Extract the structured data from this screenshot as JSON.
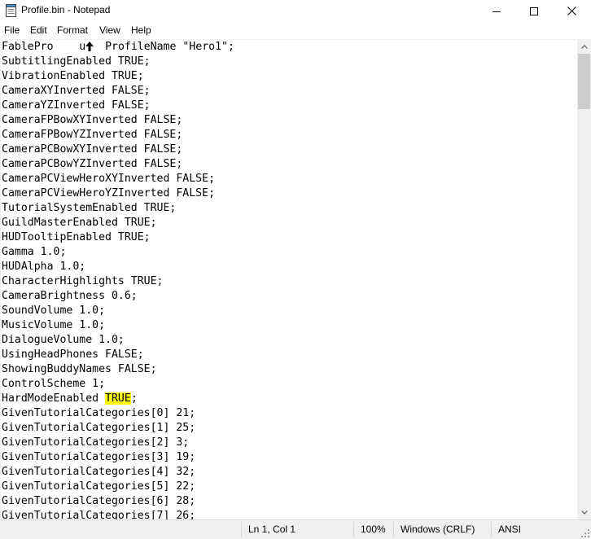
{
  "window": {
    "title": "Profile.bin - Notepad",
    "icon": "notepad-icon"
  },
  "menu": [
    "File",
    "Edit",
    "Format",
    "View",
    "Help"
  ],
  "editor": {
    "line1": {
      "prefix": "FablePro    u",
      "cursor_icon": "mouse-pointer-icon",
      "suffix": "  ProfileName \"Hero1\";"
    },
    "lines": [
      "SubtitlingEnabled TRUE;",
      "VibrationEnabled TRUE;",
      "CameraXYInverted FALSE;",
      "CameraYZInverted FALSE;",
      "CameraFPBowXYInverted FALSE;",
      "CameraFPBowYZInverted FALSE;",
      "CameraPCBowXYInverted FALSE;",
      "CameraPCBowYZInverted FALSE;",
      "CameraPCViewHeroXYInverted FALSE;",
      "CameraPCViewHeroYZInverted FALSE;",
      "TutorialSystemEnabled TRUE;",
      "GuildMasterEnabled TRUE;",
      "HUDTooltipEnabled TRUE;",
      "Gamma 1.0;",
      "HUDAlpha 1.0;",
      "CharacterHighlights TRUE;",
      "CameraBrightness 0.6;",
      "SoundVolume 1.0;",
      "MusicVolume 1.0;",
      "DialogueVolume 1.0;",
      "UsingHeadPhones FALSE;",
      "ShowingBuddyNames FALSE;",
      "ControlScheme 1;"
    ],
    "highlighted_line": {
      "prefix": "HardModeEnabled ",
      "highlight": "TRUE",
      "suffix": ";"
    },
    "lines_after": [
      "GivenTutorialCategories[0] 21;",
      "GivenTutorialCategories[1] 25;",
      "GivenTutorialCategories[2] 3;",
      "GivenTutorialCategories[3] 19;",
      "GivenTutorialCategories[4] 32;",
      "GivenTutorialCategories[5] 22;",
      "GivenTutorialCategories[6] 28;",
      "GivenTutorialCategories[7] 26;"
    ],
    "highlight_color": "#ffff00"
  },
  "status": {
    "position": "Ln 1, Col 1",
    "zoom": "100%",
    "line_ending": "Windows (CRLF)",
    "encoding": "ANSI"
  }
}
